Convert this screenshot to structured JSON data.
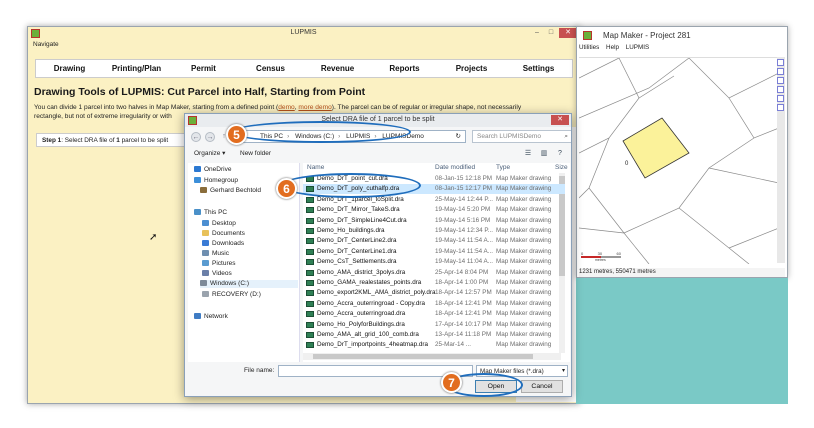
{
  "lupmis": {
    "title": "LUPMIS",
    "menu": "Navigate",
    "nav": [
      "Drawing",
      "Printing/Plan",
      "Permit",
      "Census",
      "Revenue",
      "Reports",
      "Projects",
      "Settings"
    ],
    "heading": "Drawing Tools of LUPMIS: Cut Parcel into Half, Starting from Point",
    "desc_before": "You can divide 1 parcel into two halves in Map Maker, starting from a defined point (",
    "demo_link": "demo",
    "desc_comma": ", ",
    "more_demo_link": "more demo",
    "desc_after": "). The parcel can be of regular or irregular shape, not necessarily",
    "desc_line2": "rectangle, but not of extreme irregularity or with",
    "step_label": "Step 1",
    "step_text": ": Select DRA file of ",
    "step_bold": "1",
    "step_end": " parcel to be split"
  },
  "mapmaker": {
    "title": "Map Maker - Project 281",
    "menu": [
      "Utilities",
      "Help",
      "LUPMIS"
    ],
    "status": "1231 metres, 550471 metres",
    "scale_label": "metres",
    "scale_ticks": [
      "0",
      "30",
      "60"
    ]
  },
  "dialog": {
    "title": "Select DRA file of 1 parcel to be split",
    "path": [
      "This PC",
      "Windows (C:)",
      "LUPMIS",
      "LUPMISDemo"
    ],
    "search_placeholder": "Search LUPMISDemo",
    "organize": "Organize ▾",
    "new_folder": "New folder",
    "nav_items": [
      "OneDrive",
      "Homegroup",
      "Gerhard Bechtold",
      "This PC",
      "Desktop",
      "Documents",
      "Downloads",
      "Music",
      "Pictures",
      "Videos",
      "Windows (C:)",
      "RECOVERY (D:)",
      "Network"
    ],
    "columns": {
      "name": "Name",
      "date": "Date modified",
      "type": "Type",
      "size": "Size"
    },
    "files": [
      {
        "name": "Demo_DrT_point_cut.dra",
        "date": "08-Jan-15 12:18 PM",
        "type": "Map Maker drawing"
      },
      {
        "name": "Demo_DrT_poly_cuthalfp.dra",
        "date": "08-Jan-15 12:17 PM",
        "type": "Map Maker drawing"
      },
      {
        "name": "Demo_DrT_1parcel_toSplit.dra",
        "date": "25-May-14 12:44 P...",
        "type": "Map Maker drawing"
      },
      {
        "name": "Demo_DrT_Mirror_TakeS.dra",
        "date": "19-May-14 5:20 PM",
        "type": "Map Maker drawing"
      },
      {
        "name": "Demo_DrT_SimpleLine4Cut.dra",
        "date": "19-May-14 5:16 PM",
        "type": "Map Maker drawing"
      },
      {
        "name": "Demo_Ho_buildings.dra",
        "date": "19-May-14 12:34 P...",
        "type": "Map Maker drawing"
      },
      {
        "name": "Demo_DrT_CenterLine2.dra",
        "date": "19-May-14 11:54 A...",
        "type": "Map Maker drawing"
      },
      {
        "name": "Demo_DrT_CenterLine1.dra",
        "date": "19-May-14 11:54 A...",
        "type": "Map Maker drawing"
      },
      {
        "name": "Demo_CsT_Settlements.dra",
        "date": "19-May-14 11:04 A...",
        "type": "Map Maker drawing"
      },
      {
        "name": "Demo_AMA_district_3polys.dra",
        "date": "25-Apr-14 8:04 PM",
        "type": "Map Maker drawing"
      },
      {
        "name": "Demo_GAMA_realestates_points.dra",
        "date": "18-Apr-14 1:00 PM",
        "type": "Map Maker drawing"
      },
      {
        "name": "Demo_export2KML_AMA_district_poly.dra",
        "date": "18-Apr-14 12:57 PM",
        "type": "Map Maker drawing"
      },
      {
        "name": "Demo_Accra_outerringroad - Copy.dra",
        "date": "18-Apr-14 12:41 PM",
        "type": "Map Maker drawing"
      },
      {
        "name": "Demo_Accra_outerringroad.dra",
        "date": "18-Apr-14 12:41 PM",
        "type": "Map Maker drawing"
      },
      {
        "name": "Demo_Ho_PolyforBuildings.dra",
        "date": "17-Apr-14 10:17 PM",
        "type": "Map Maker drawing"
      },
      {
        "name": "Demo_AMA_alt_grid_100_comb.dra",
        "date": "13-Apr-14 11:18 PM",
        "type": "Map Maker drawing"
      },
      {
        "name": "Demo_DrT_importpoints_4heatmap.dra",
        "date": "25-Mar-14 ...",
        "type": "Map Maker drawing"
      }
    ],
    "filename_label": "File name:",
    "filename_value": "",
    "filter": "Map Maker files (*.dra)",
    "open": "Open",
    "cancel": "Cancel"
  },
  "callouts": [
    "5",
    "6",
    "7"
  ],
  "colors": {
    "callout": "#e26d1f",
    "ring": "#1f6dbc",
    "parcel": "#fbf29a",
    "teal": "#7ac9c6"
  }
}
